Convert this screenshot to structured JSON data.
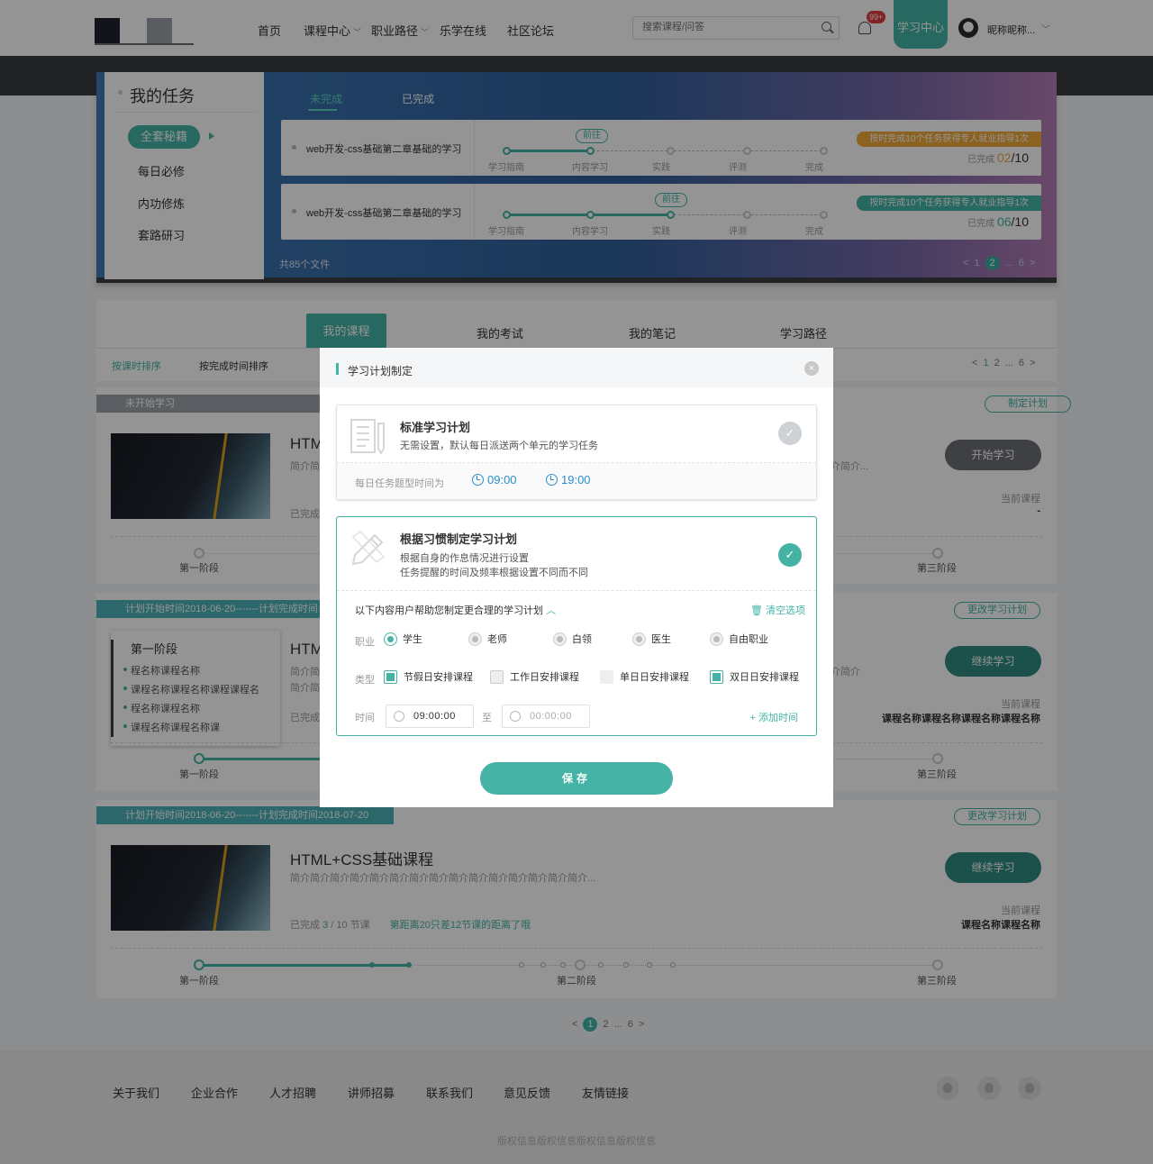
{
  "header": {
    "nav": [
      {
        "label": "首页",
        "dropdown": false
      },
      {
        "label": "课程中心",
        "dropdown": true
      },
      {
        "label": "职业路径",
        "dropdown": true
      },
      {
        "label": "乐学在线",
        "dropdown": false
      },
      {
        "label": "社区论坛",
        "dropdown": false
      }
    ],
    "search_placeholder": "搜索课程/问答",
    "badge": "99+",
    "learn_center": "学习中心",
    "nickname": "昵称昵称...",
    "accent": "#44b3a5"
  },
  "tasks": {
    "title": "我的任务",
    "side_items": [
      "全套秘籍",
      "每日必修",
      "内功修炼",
      "套路研习"
    ],
    "tabs": [
      "未完成",
      "已完成"
    ],
    "cards": [
      {
        "name": "web开发-css基础第二章基础的学习",
        "goto": "前往",
        "stages": [
          "学习指南",
          "内容学习",
          "实践",
          "评测",
          "完成"
        ],
        "progress": 0.27,
        "ribbon": "按时完成10个任务获得专人就业指导1次",
        "ribbon_color": "#f0a93a",
        "done_label": "已完成",
        "done": "02",
        "done_color": "#f0a93a",
        "total": "/10"
      },
      {
        "name": "web开发-css基础第二章基础的学习",
        "goto": "前往",
        "stages": [
          "学习指南",
          "内容学习",
          "实践",
          "评测",
          "完成"
        ],
        "progress": 0.52,
        "ribbon": "按时完成10个任务获得专人就业指导1次",
        "ribbon_color": "#44b3a5",
        "done_label": "已完成",
        "done": "06",
        "done_color": "#44b3a5",
        "total": "/10"
      }
    ],
    "file_count": "共85个文件",
    "pager": {
      "prev": "<",
      "p1": "1",
      "cur": "2",
      "ellipsis": "...",
      "last": "6",
      "next": ">"
    }
  },
  "courses": {
    "tabs": [
      "我的课程",
      "我的考试",
      "我的笔记",
      "学习路径"
    ],
    "sorts": [
      "按课时排序",
      "按完成时间排序"
    ],
    "pager": {
      "prev": "<",
      "cur": "1",
      "p2": "2",
      "ellipsis": "...",
      "last": "6",
      "next": ">"
    },
    "cards": [
      {
        "head": "未开始学习",
        "action_tag": "制定计划",
        "title": "HTM",
        "desc": "简介简",
        "desc_right": "介简介...",
        "meta": "已完成",
        "button": "开始学习",
        "current_label": "当前课程",
        "current_value": "-",
        "stage_labels": [
          "第一阶段",
          "第三阶段"
        ]
      },
      {
        "head": "计划开始时间2018-06-20-------计划完成时间",
        "action_tag": "更改学习计划",
        "title": "HTM",
        "desc": "简介简",
        "desc2": "简介简",
        "desc_right": "介简介",
        "meta": "已完成",
        "button": "继续学习",
        "current_label": "当前课程",
        "current_value": "课程名称课程名称课程名称课程名称",
        "stage_labels": [
          "第一阶段",
          "第三阶段"
        ],
        "stage_popup": {
          "title": "第一阶段",
          "items": [
            "程名称课程名称",
            "课程名称课程名称课程课程名",
            "程名称课程名称",
            "课程名称课程名称课"
          ]
        }
      },
      {
        "head": "计划开始时间2018-06-20-------计划完成时间2018-07-20",
        "action_tag": "更改学习计划",
        "title": "HTML+CSS基础课程",
        "desc": "简介简介简介简介简介简介简介简介简介简介简介简介简介简介简介...",
        "meta_prefix": "已完成",
        "meta_done": "3",
        "meta_total": "/ 10 节课",
        "meta_tip": "第距离20只差12节课的距离了哦",
        "button": "继续学习",
        "current_label": "当前课程",
        "current_value": "课程名称课程名称",
        "stage_labels": [
          "第一阶段",
          "第二阶段",
          "第三阶段"
        ]
      }
    ],
    "bottom_pager": {
      "prev": "<",
      "cur": "1",
      "p2": "2",
      "ellipsis": "...",
      "last": "6",
      "next": ">"
    }
  },
  "modal": {
    "title": "学习计划制定",
    "close": "×",
    "option1": {
      "title": "标准学习计划",
      "desc": "无需设置，默认每日派送两个单元的学习任务",
      "time_label": "每日任务题型时间为",
      "time1": "09:00",
      "time2": "19:00",
      "selected": false
    },
    "option2": {
      "title": "根据习惯制定学习计划",
      "desc1": "根据自身的作息情况进行设置",
      "desc2": "任务提醒的时间及频率根据设置不同而不同",
      "selected": true,
      "help": "以下内容用户帮助您制定更合理的学习计划",
      "clear": "清空选项",
      "job_label": "职业",
      "jobs": [
        "学生",
        "老师",
        "白领",
        "医生",
        "自由职业"
      ],
      "job_selected": "学生",
      "type_label": "类型",
      "types": [
        {
          "label": "节假日安排课程",
          "checked": true
        },
        {
          "label": "工作日安排课程",
          "checked": false
        },
        {
          "label": "单日日安排课程",
          "checked": false
        },
        {
          "label": "双日日安排课程",
          "checked": true
        }
      ],
      "time_label": "时间",
      "time_from": "09:00:00",
      "to": "至",
      "time_to": "00:00:00",
      "add_time": "+ 添加时间"
    },
    "save": "保存"
  },
  "footer": {
    "links": [
      "关于我们",
      "企业合作",
      "人才招聘",
      "讲师招募",
      "联系我们",
      "意见反馈",
      "友情链接"
    ],
    "copyright": "版权信息版权信息版权信息版权信息"
  }
}
